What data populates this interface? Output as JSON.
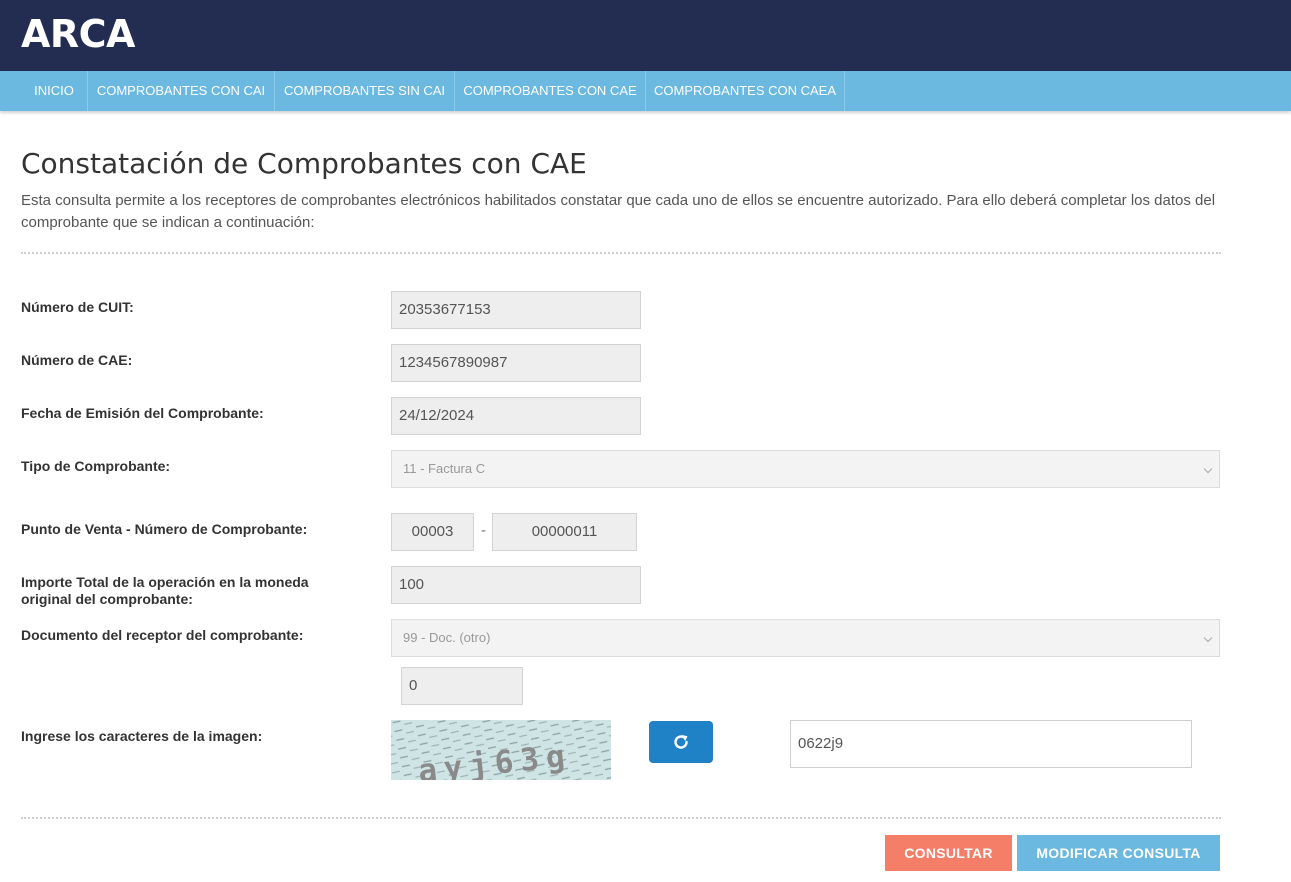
{
  "header": {
    "logo": "ARCA"
  },
  "nav": {
    "items": [
      {
        "label": "INICIO"
      },
      {
        "label": "COMPROBANTES CON CAI"
      },
      {
        "label": "COMPROBANTES SIN CAI"
      },
      {
        "label": "COMPROBANTES CON CAE"
      },
      {
        "label": "COMPROBANTES CON CAEA"
      }
    ]
  },
  "main": {
    "title": "Constatación de Comprobantes con CAE",
    "description": "Esta consulta permite a los receptores de comprobantes electrónicos habilitados constatar que cada uno de ellos se encuentre autorizado. Para ello deberá completar los datos del comprobante que se indican a continuación:"
  },
  "form": {
    "cuit": {
      "label": "Número de CUIT:",
      "value": "20353677153"
    },
    "cae": {
      "label": "Número de CAE:",
      "value": "1234567890987"
    },
    "fecha": {
      "label": "Fecha de Emisión del Comprobante:",
      "value": "24/12/2024"
    },
    "tipo": {
      "label": "Tipo de Comprobante:",
      "selected": "11 - Factura C"
    },
    "punto_venta": {
      "label": "Punto de Venta - Número de Comprobante:",
      "punto": "00003",
      "separator": "-",
      "numero": "00000011"
    },
    "importe": {
      "label": "Importe Total de la operación en la moneda original del comprobante:",
      "value": "100"
    },
    "documento": {
      "label": "Documento del receptor del comprobante:",
      "selected": "99 - Doc. (otro)",
      "numero": "0"
    },
    "captcha": {
      "label": "Ingrese los caracteres de la imagen:",
      "image_text": "ayj63g",
      "value": "0622j9",
      "refresh_icon": "refresh-icon"
    }
  },
  "actions": {
    "consultar": "CONSULTAR",
    "modificar": "MODIFICAR CONSULTA"
  }
}
